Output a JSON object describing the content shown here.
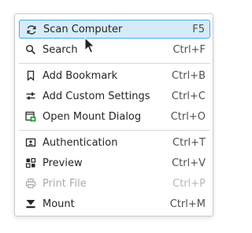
{
  "menu": {
    "items": [
      {
        "label": "Scan Computer",
        "shortcut": "F5",
        "icon": "refresh-icon",
        "highlighted": true,
        "disabled": false
      },
      {
        "label": "Search",
        "shortcut": "Ctrl+F",
        "icon": "search-icon",
        "highlighted": false,
        "disabled": false
      },
      {
        "label": "Add Bookmark",
        "shortcut": "Ctrl+B",
        "icon": "bookmark-icon",
        "highlighted": false,
        "disabled": false
      },
      {
        "label": "Add Custom Settings",
        "shortcut": "Ctrl+C",
        "icon": "settings-sliders-icon",
        "highlighted": false,
        "disabled": false
      },
      {
        "label": "Open Mount Dialog",
        "shortcut": "Ctrl+O",
        "icon": "mount-dialog-icon",
        "highlighted": false,
        "disabled": false
      },
      {
        "label": "Authentication",
        "shortcut": "Ctrl+T",
        "icon": "authentication-icon",
        "highlighted": false,
        "disabled": false
      },
      {
        "label": "Preview",
        "shortcut": "Ctrl+V",
        "icon": "preview-grid-icon",
        "highlighted": false,
        "disabled": false
      },
      {
        "label": "Print File",
        "shortcut": "Ctrl+P",
        "icon": "printer-icon",
        "highlighted": false,
        "disabled": true
      },
      {
        "label": "Mount",
        "shortcut": "Ctrl+M",
        "icon": "mount-icon",
        "highlighted": false,
        "disabled": false
      }
    ]
  },
  "colors": {
    "highlight_fill": "#d6ebfa",
    "highlight_border": "#3daee9",
    "text": "#232629",
    "disabled_text": "#a8aaad",
    "mount_dialog_icon_green": "#2e9e3e"
  }
}
